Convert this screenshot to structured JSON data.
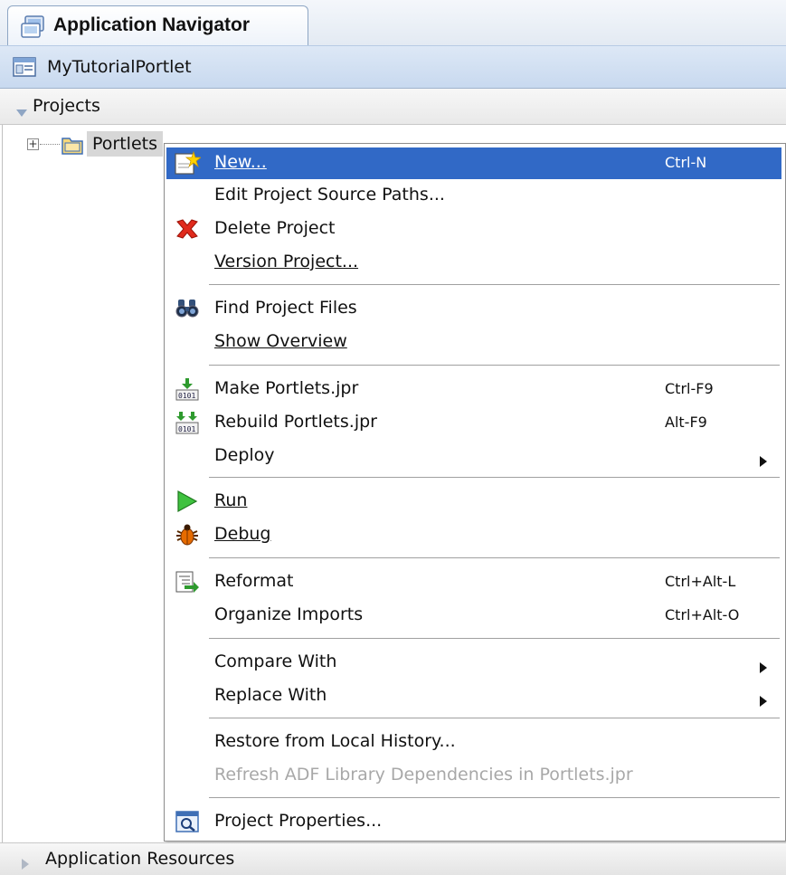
{
  "window": {
    "title": "Application Navigator"
  },
  "application": {
    "name": "MyTutorialPortlet"
  },
  "projects_panel": {
    "label": "Projects"
  },
  "tree": {
    "node_label": "Portlets"
  },
  "resources_panel": {
    "label": "Application Resources"
  },
  "menu": {
    "items": [
      {
        "label": "New...",
        "shortcut": "Ctrl-N",
        "icon": "new-gallery-icon"
      },
      {
        "label": "Edit Project Source Paths...",
        "shortcut": ""
      },
      {
        "label": "Delete Project",
        "shortcut": "",
        "icon": "delete-x-icon"
      },
      {
        "label": "Version Project...",
        "shortcut": ""
      },
      {
        "label": "Find Project Files",
        "shortcut": "",
        "icon": "binoculars-icon"
      },
      {
        "label": "Show Overview",
        "shortcut": ""
      },
      {
        "label": "Make Portlets.jpr",
        "shortcut": "Ctrl-F9",
        "icon": "make-icon"
      },
      {
        "label": "Rebuild Portlets.jpr",
        "shortcut": "Alt-F9",
        "icon": "rebuild-icon"
      },
      {
        "label": "Deploy",
        "shortcut": "",
        "submenu": true
      },
      {
        "label": "Run",
        "shortcut": "",
        "icon": "run-icon"
      },
      {
        "label": "Debug",
        "shortcut": "",
        "icon": "bug-icon"
      },
      {
        "label": "Reformat",
        "shortcut": "Ctrl+Alt-L",
        "icon": "reformat-icon"
      },
      {
        "label": "Organize Imports",
        "shortcut": "Ctrl+Alt-O"
      },
      {
        "label": "Compare With",
        "shortcut": "",
        "submenu": true
      },
      {
        "label": "Replace With",
        "shortcut": "",
        "submenu": true
      },
      {
        "label": "Restore from Local History...",
        "shortcut": ""
      },
      {
        "label": "Refresh ADF Library Dependencies in Portlets.jpr",
        "shortcut": "",
        "disabled": true
      },
      {
        "label": "Project Properties...",
        "shortcut": "",
        "icon": "properties-icon"
      }
    ]
  },
  "colors": {
    "selection": "#3169c6",
    "disabled_text": "#a8a8a8"
  }
}
